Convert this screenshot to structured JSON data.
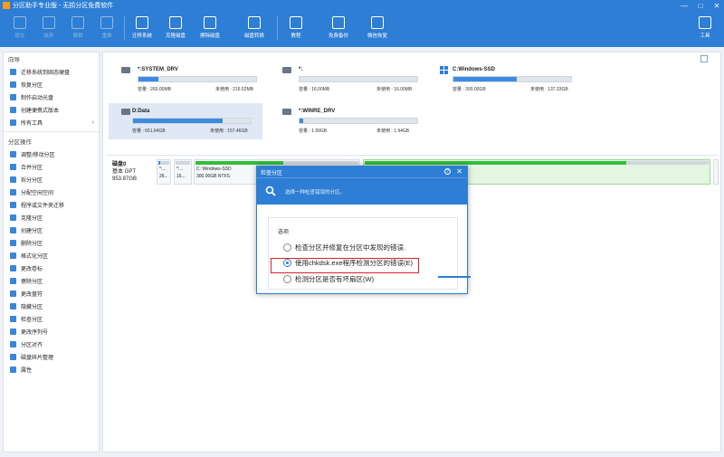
{
  "window": {
    "title": "分区助手专业版 - 无损分区免费软件",
    "controls": [
      "—",
      "□",
      "✕"
    ]
  },
  "toolbar": {
    "buttons": [
      {
        "label": "提交",
        "icon": "check-icon",
        "enabled": false
      },
      {
        "label": "放弃",
        "icon": "close-icon",
        "enabled": false
      },
      {
        "label": "撤销",
        "icon": "undo-icon",
        "enabled": false
      },
      {
        "label": "重做",
        "icon": "redo-icon",
        "enabled": false
      },
      {
        "label": "迁移系统",
        "icon": "migrate-icon",
        "enabled": true
      },
      {
        "label": "克隆磁盘",
        "icon": "clone-icon",
        "enabled": true
      },
      {
        "label": "擦除磁盘",
        "icon": "wipe-icon",
        "enabled": true
      },
      {
        "label": "磁盘转换",
        "icon": "convert-icon",
        "enabled": true
      },
      {
        "label": "教程",
        "icon": "tutorial-icon",
        "enabled": true
      },
      {
        "label": "免费备份",
        "icon": "backup-icon",
        "enabled": true
      },
      {
        "label": "微信恢复",
        "icon": "recovery-icon",
        "enabled": true
      },
      {
        "label": "工具",
        "icon": "tools-icon",
        "enabled": true
      }
    ]
  },
  "sidebar": {
    "wizard_title": "向导",
    "wizard_items": [
      {
        "label": "迁移系统到固态硬盘"
      },
      {
        "label": "恢复分区"
      },
      {
        "label": "制作启动光盘"
      },
      {
        "label": "创建便携式版本"
      },
      {
        "label": "所有工具",
        "chevron": "›"
      }
    ],
    "ops_title": "分区操作",
    "ops_items": [
      "调整/移动分区",
      "合并分区",
      "拆分分区",
      "分配空闲空间",
      "程序或文件夹迁移",
      "克隆分区",
      "创建分区",
      "删除分区",
      "格式化分区",
      "更改卷标",
      "擦除分区",
      "更改盘符",
      "隐藏分区",
      "检查分区",
      "更改序列号",
      "分区对齐",
      "磁盘碎片整理",
      "属性"
    ]
  },
  "disks": {
    "cards": [
      {
        "name": "*:SYSTEM_DRV",
        "capacity": "容量 : 260.00MB",
        "free": "未使用 : 216.52MB",
        "fill": 0.17
      },
      {
        "name": "*:",
        "capacity": "容量 : 16.00MB",
        "free": "未使用 : 16.00MB",
        "fill": 0.0
      },
      {
        "name": "C:Windows-SSD",
        "capacity": "容量 : 300.00GB",
        "free": "未使用 : 137.33GB",
        "fill": 0.54
      },
      {
        "name": "D:Data",
        "capacity": "容量 : 651.64GB",
        "free": "未使用 : 157.46GB",
        "fill": 0.76
      },
      {
        "name": "*:WINRE_DRV",
        "capacity": "容量 : 1.99GB",
        "free": "未使用 : 1.94GB",
        "fill": 0.03
      }
    ],
    "disk0": {
      "label": "磁盘0",
      "type": "基本 GPT",
      "size": "953.87GB",
      "parts": [
        {
          "name": "*:...",
          "size": "26..."
        },
        {
          "name": "*:...",
          "size": "16..."
        },
        {
          "name": "C: Windows-SSD",
          "size": "300.00GB NTFS"
        }
      ]
    }
  },
  "dialog": {
    "title": "检查分区",
    "help": "?",
    "close": "✕",
    "header_text": "选择一种检查错误的分区。",
    "group_label": "选项",
    "options": [
      {
        "label": "检查分区并修复在分区中发现的错误.",
        "selected": false
      },
      {
        "label": "使用chkdsk.exe程序检测分区的错误(E)",
        "selected": true
      },
      {
        "label": "检测分区是否有坏扇区(W)",
        "selected": false
      }
    ]
  },
  "colors": {
    "accent": "#2d7ed4",
    "highlight": "#d8212b",
    "bar": "#3d8be0",
    "partition_green": "#2fbf3a"
  }
}
